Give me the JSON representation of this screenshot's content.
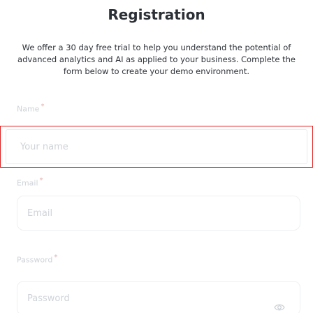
{
  "form": {
    "title": "Registration",
    "intro": "We offer a 30 day free trial to help you understand the potential of advanced analytics and AI as applied to your business. Complete the form below to create your demo environment.",
    "fields": {
      "name": {
        "label": "Name",
        "required_marker": "*",
        "placeholder": "Your name",
        "value": ""
      },
      "email": {
        "label": "Email",
        "required_marker": "*",
        "placeholder": "Email",
        "value": ""
      },
      "password": {
        "label": "Password",
        "required_marker": "*",
        "placeholder": "Password",
        "value": "",
        "toggle_icon": "eye-icon"
      }
    }
  },
  "colors": {
    "heading": "#2b2f36",
    "placeholder": "#cfd3d8",
    "focus_outline": "#e02020"
  }
}
